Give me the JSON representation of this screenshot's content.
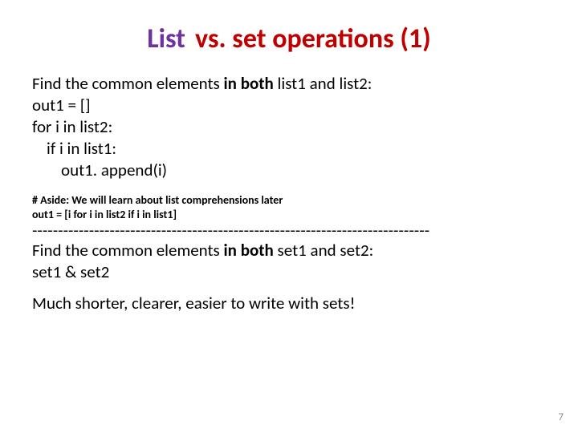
{
  "title": {
    "part1": "List",
    "part2": "vs.",
    "part3": "set operations (1)"
  },
  "list_section": {
    "find_prefix": "Find the common elements ",
    "in_both": "in both",
    "list1": " list1 ",
    "and": "and",
    "list2": " list2:",
    "code_l1": "out1 = []",
    "code_l2": "for i in list2:",
    "code_l3": "if i in list1:",
    "code_l4": "out1. append(i)"
  },
  "aside": {
    "l1": "# Aside: We will learn about list comprehensions later",
    "l2": "out1 = [i for i in list2 if i in list1]"
  },
  "divider": "-----------------------------------------------------------------------------",
  "set_section": {
    "find_prefix": "Find the common elements ",
    "in_both": "in both",
    "set1": " set1 ",
    "and": "and",
    "set2": " set2:",
    "expr": "set1 & set2"
  },
  "closing": "Much shorter, clearer, easier to write with sets!",
  "page_number": "7"
}
